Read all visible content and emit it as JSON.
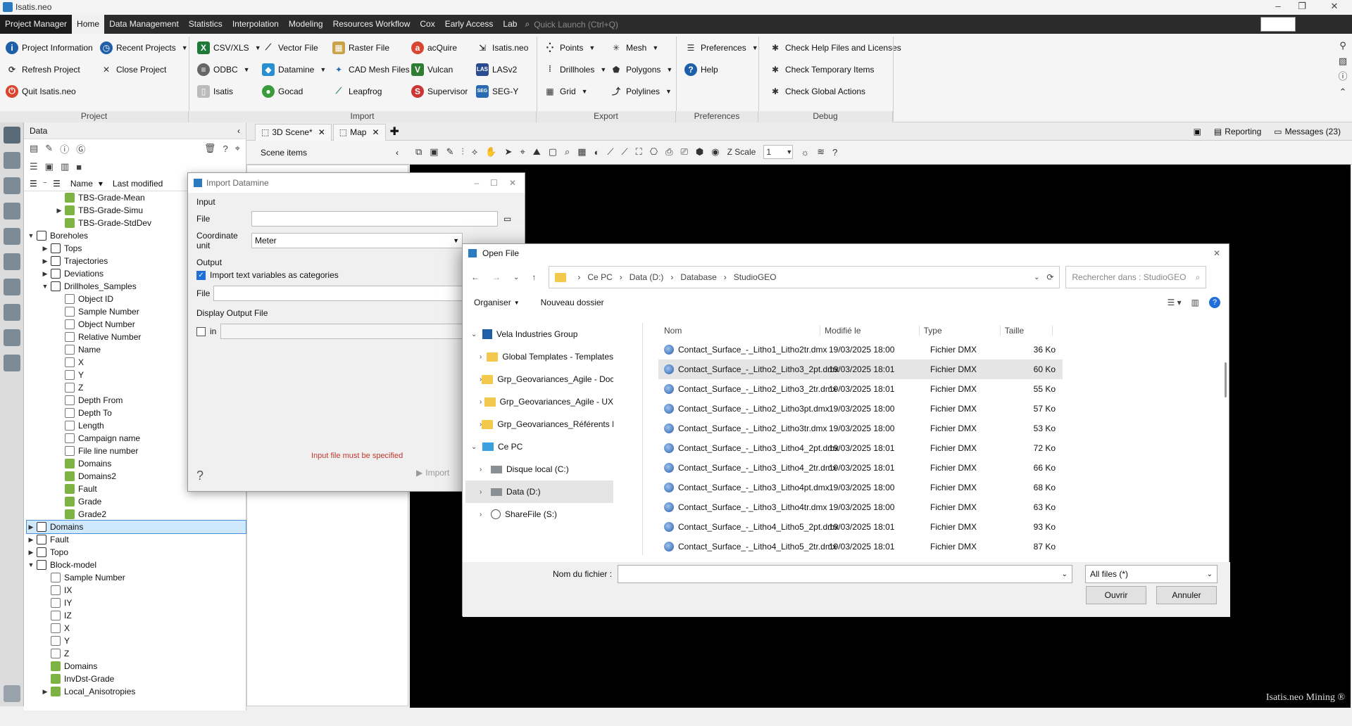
{
  "app": {
    "title": "Isatis.neo"
  },
  "menu": {
    "items": [
      "Project Manager",
      "Home",
      "Data Management",
      "Statistics",
      "Interpolation",
      "Modeling",
      "Resources Workflow",
      "Cox",
      "Early Access",
      "Lab"
    ],
    "quick_launch": "Quick Launch (Ctrl+Q)"
  },
  "ribbon": {
    "project": {
      "label": "Project",
      "project_information": "Project Information",
      "recent_projects": "Recent Projects",
      "refresh_project": "Refresh Project",
      "close_project": "Close Project",
      "quit": "Quit Isatis.neo"
    },
    "import": {
      "label": "Import",
      "csv": "CSV/XLS",
      "vector": "Vector File",
      "raster": "Raster File",
      "acquire": "acQuire",
      "isatisneo": "Isatis.neo",
      "odbc": "ODBC",
      "datamine": "Datamine",
      "cad": "CAD Mesh Files",
      "vulcan": "Vulcan",
      "lasv2": "LASv2",
      "isatis": "Isatis",
      "gocad": "Gocad",
      "leapfrog": "Leapfrog",
      "supervisor": "Supervisor",
      "segy": "SEG-Y"
    },
    "export": {
      "label": "Export",
      "points": "Points",
      "mesh": "Mesh",
      "drillholes": "Drillholes",
      "polygons": "Polygons",
      "grid": "Grid",
      "polylines": "Polylines"
    },
    "preferences": {
      "label": "Preferences",
      "preferences": "Preferences",
      "help": "Help"
    },
    "debug": {
      "label": "Debug",
      "check_help": "Check Help Files and Licenses",
      "check_temp": "Check Temporary Items",
      "check_global": "Check Global Actions"
    }
  },
  "data_panel": {
    "title": "Data",
    "col_name": "Name",
    "col_modified": "Last modified",
    "tree": [
      {
        "label": "TBS-Grade-Mean",
        "indent": 2,
        "arrow": "",
        "icon": "green"
      },
      {
        "label": "TBS-Grade-Simu",
        "indent": 2,
        "arrow": ">",
        "icon": "green"
      },
      {
        "label": "TBS-Grade-StdDev",
        "indent": 2,
        "arrow": "",
        "icon": "green"
      },
      {
        "label": "Boreholes",
        "indent": 0,
        "arrow": "v",
        "icon": "dark"
      },
      {
        "label": "Tops",
        "indent": 1,
        "arrow": ">",
        "icon": "dark"
      },
      {
        "label": "Trajectories",
        "indent": 1,
        "arrow": ">",
        "icon": "dark"
      },
      {
        "label": "Deviations",
        "indent": 1,
        "arrow": ">",
        "icon": "dark"
      },
      {
        "label": "Drillholes_Samples",
        "indent": 1,
        "arrow": "v",
        "icon": "dark"
      },
      {
        "label": "Object ID",
        "indent": 2,
        "arrow": "",
        "icon": "gray"
      },
      {
        "label": "Sample Number",
        "indent": 2,
        "arrow": "",
        "icon": "gray"
      },
      {
        "label": "Object Number",
        "indent": 2,
        "arrow": "",
        "icon": "gray"
      },
      {
        "label": "Relative Number",
        "indent": 2,
        "arrow": "",
        "icon": "gray"
      },
      {
        "label": "Name",
        "indent": 2,
        "arrow": "",
        "icon": "gray"
      },
      {
        "label": "X",
        "indent": 2,
        "arrow": "",
        "icon": "gray"
      },
      {
        "label": "Y",
        "indent": 2,
        "arrow": "",
        "icon": "gray"
      },
      {
        "label": "Z",
        "indent": 2,
        "arrow": "",
        "icon": "gray"
      },
      {
        "label": "Depth From",
        "indent": 2,
        "arrow": "",
        "icon": "gray"
      },
      {
        "label": "Depth To",
        "indent": 2,
        "arrow": "",
        "icon": "gray"
      },
      {
        "label": "Length",
        "indent": 2,
        "arrow": "",
        "icon": "gray"
      },
      {
        "label": "Campaign name",
        "indent": 2,
        "arrow": "",
        "icon": "gray"
      },
      {
        "label": "File line number",
        "indent": 2,
        "arrow": "",
        "icon": "gray"
      },
      {
        "label": "Domains",
        "indent": 2,
        "arrow": "",
        "icon": "green"
      },
      {
        "label": "Domains2",
        "indent": 2,
        "arrow": "",
        "icon": "green"
      },
      {
        "label": "Fault",
        "indent": 2,
        "arrow": "",
        "icon": "green"
      },
      {
        "label": "Grade",
        "indent": 2,
        "arrow": "",
        "icon": "green"
      },
      {
        "label": "Grade2",
        "indent": 2,
        "arrow": "",
        "icon": "green"
      },
      {
        "label": "Domains",
        "indent": 0,
        "arrow": ">",
        "icon": "dark",
        "selected": true
      },
      {
        "label": "Fault",
        "indent": 0,
        "arrow": ">",
        "icon": "dark"
      },
      {
        "label": "Topo",
        "indent": 0,
        "arrow": ">",
        "icon": "dark"
      },
      {
        "label": "Block-model",
        "indent": 0,
        "arrow": "v",
        "icon": "dark"
      },
      {
        "label": "Sample Number",
        "indent": 1,
        "arrow": "",
        "icon": "gray"
      },
      {
        "label": "IX",
        "indent": 1,
        "arrow": "",
        "icon": "gray"
      },
      {
        "label": "IY",
        "indent": 1,
        "arrow": "",
        "icon": "gray"
      },
      {
        "label": "IZ",
        "indent": 1,
        "arrow": "",
        "icon": "gray"
      },
      {
        "label": "X",
        "indent": 1,
        "arrow": "",
        "icon": "gray"
      },
      {
        "label": "Y",
        "indent": 1,
        "arrow": "",
        "icon": "gray"
      },
      {
        "label": "Z",
        "indent": 1,
        "arrow": "",
        "icon": "gray"
      },
      {
        "label": "Domains",
        "indent": 1,
        "arrow": "",
        "icon": "green"
      },
      {
        "label": "InvDst-Grade",
        "indent": 1,
        "arrow": "",
        "icon": "green"
      },
      {
        "label": "Local_Anisotropies",
        "indent": 1,
        "arrow": ">",
        "icon": "green"
      }
    ]
  },
  "viewer": {
    "tabs": [
      "3D Scene*",
      "Map"
    ],
    "scene_items": "Scene items",
    "zscale_label": "Z Scale",
    "zscale_value": "1",
    "reporting": "Reporting",
    "messages": "Messages (23)",
    "brand": "Isatis.neo Mining ®"
  },
  "import_datamine": {
    "title": "Import Datamine",
    "input": "Input",
    "file_label": "File",
    "coord_label": "Coordinate unit",
    "coord_value": "Meter",
    "output": "Output",
    "import_text_vars": "Import text variables as categories",
    "file2_label": "File",
    "display_output": "Display Output File",
    "in_label": "in",
    "error": "Input file must be specified",
    "import_button": "Import"
  },
  "open_file": {
    "title": "Open File",
    "breadcrumb": [
      "Ce PC",
      "Data (D:)",
      "Database",
      "StudioGEO"
    ],
    "search_placeholder": "Rechercher dans : StudioGEO",
    "organiser": "Organiser",
    "new_folder": "Nouveau dossier",
    "columns": {
      "name": "Nom",
      "modified": "Modifié le",
      "type": "Type",
      "size": "Taille"
    },
    "nav": [
      {
        "label": "Vela Industries Group",
        "indent": 0,
        "arrow": "v",
        "kind": "group"
      },
      {
        "label": "Global Templates - Templates",
        "indent": 1,
        "arrow": ">",
        "kind": "folder"
      },
      {
        "label": "Grp_Geovariances_Agile - Documer",
        "indent": 1,
        "arrow": ">",
        "kind": "folder"
      },
      {
        "label": "Grp_Geovariances_Agile - UX",
        "indent": 1,
        "arrow": ">",
        "kind": "folder"
      },
      {
        "label": "Grp_Geovariances_Référents Départ",
        "indent": 1,
        "arrow": ">",
        "kind": "folder"
      },
      {
        "label": "Ce PC",
        "indent": 0,
        "arrow": "v",
        "kind": "pc"
      },
      {
        "label": "Disque local (C:)",
        "indent": 1,
        "arrow": ">",
        "kind": "drive"
      },
      {
        "label": "Data (D:)",
        "indent": 1,
        "arrow": ">",
        "kind": "drive",
        "selected": true
      },
      {
        "label": "ShareFile (S:)",
        "indent": 1,
        "arrow": ">",
        "kind": "share"
      }
    ],
    "files": [
      {
        "name": "Contact_Surface_-_Litho1_Litho2tr.dmx",
        "modified": "19/03/2025 18:00",
        "type": "Fichier DMX",
        "size": "36 Ko"
      },
      {
        "name": "Contact_Surface_-_Litho2_Litho3_2pt.dmx",
        "modified": "19/03/2025 18:01",
        "type": "Fichier DMX",
        "size": "60 Ko",
        "hover": true
      },
      {
        "name": "Contact_Surface_-_Litho2_Litho3_2tr.dmx",
        "modified": "19/03/2025 18:01",
        "type": "Fichier DMX",
        "size": "55 Ko"
      },
      {
        "name": "Contact_Surface_-_Litho2_Litho3pt.dmx",
        "modified": "19/03/2025 18:00",
        "type": "Fichier DMX",
        "size": "57 Ko"
      },
      {
        "name": "Contact_Surface_-_Litho2_Litho3tr.dmx",
        "modified": "19/03/2025 18:00",
        "type": "Fichier DMX",
        "size": "53 Ko"
      },
      {
        "name": "Contact_Surface_-_Litho3_Litho4_2pt.dmx",
        "modified": "19/03/2025 18:01",
        "type": "Fichier DMX",
        "size": "72 Ko"
      },
      {
        "name": "Contact_Surface_-_Litho3_Litho4_2tr.dmx",
        "modified": "19/03/2025 18:01",
        "type": "Fichier DMX",
        "size": "66 Ko"
      },
      {
        "name": "Contact_Surface_-_Litho3_Litho4pt.dmx",
        "modified": "19/03/2025 18:00",
        "type": "Fichier DMX",
        "size": "68 Ko"
      },
      {
        "name": "Contact_Surface_-_Litho3_Litho4tr.dmx",
        "modified": "19/03/2025 18:00",
        "type": "Fichier DMX",
        "size": "63 Ko"
      },
      {
        "name": "Contact_Surface_-_Litho4_Litho5_2pt.dmx",
        "modified": "19/03/2025 18:01",
        "type": "Fichier DMX",
        "size": "93 Ko"
      },
      {
        "name": "Contact_Surface_-_Litho4_Litho5_2tr.dmx",
        "modified": "19/03/2025 18:01",
        "type": "Fichier DMX",
        "size": "87 Ko"
      }
    ],
    "filename_label": "Nom du fichier :",
    "filetype": "All files (*)",
    "open_button": "Ouvrir",
    "cancel_button": "Annuler"
  }
}
